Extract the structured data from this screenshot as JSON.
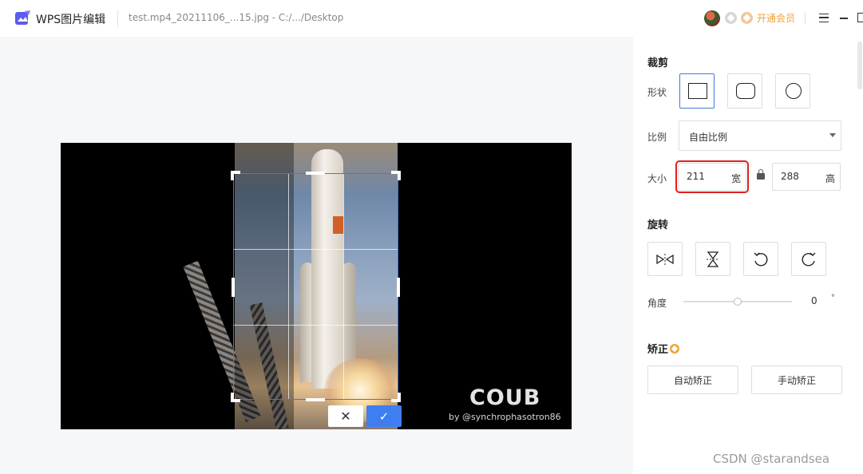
{
  "titlebar": {
    "app_name": "WPS图片编辑",
    "file_name": "test.mp4_20211106_...15.jpg - C:/.../Desktop",
    "vip_label": "开通会员"
  },
  "canvas": {
    "watermark": "COUB",
    "watermark_sub": "by @synchrophasotron86",
    "cancel_symbol": "✕",
    "confirm_symbol": "✓"
  },
  "panel": {
    "crop_title": "裁剪",
    "shape_label": "形状",
    "shapes": [
      "rectangle",
      "rounded-rectangle",
      "circle"
    ],
    "selected_shape": "rectangle",
    "ratio_label": "比例",
    "ratio_value": "自由比例",
    "size_label": "大小",
    "width_value": "211",
    "width_unit": "宽",
    "height_value": "288",
    "height_unit": "高",
    "rotate_title": "旋转",
    "angle_label": "角度",
    "angle_value": "0",
    "angle_unit": "°",
    "angle_level": 0.5,
    "correct_title": "矫正",
    "auto_correct_label": "自动矫正",
    "manual_correct_label": "手动矫正"
  },
  "footer": {
    "credit": "CSDN @starandsea"
  },
  "colors": {
    "accent": "#3f78e0",
    "confirm": "#3f7ef0",
    "highlight": "#e1201d",
    "vip": "#f0a23b"
  }
}
